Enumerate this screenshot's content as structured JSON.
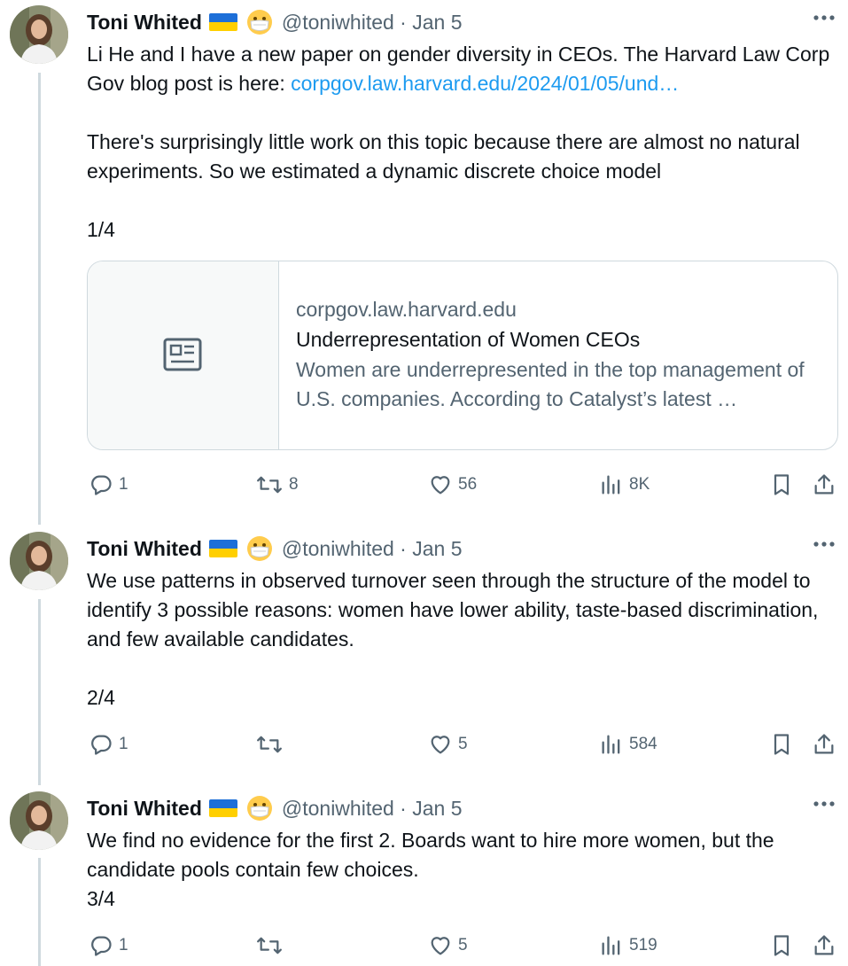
{
  "author": {
    "name": "Toni Whited",
    "handle": "@toniwhited",
    "date": "Jan 5"
  },
  "tweets": [
    {
      "body_line1_prefix": "Li He and I have a new paper on gender diversity in CEOs. The Harvard Law Corp Gov blog post is here: ",
      "link": "corpgov.law.harvard.edu/2024/01/05/und…",
      "body_para2": "There's surprisingly little work on this topic because there are almost no natural experiments. So we estimated a dynamic discrete choice model",
      "counter": "1/4",
      "card": {
        "domain": "corpgov.law.harvard.edu",
        "title": "Underrepresentation of Women CEOs",
        "description": "Women are underrepresented in the top management of U.S. companies. According to Catalyst’s latest …",
        "icon": "article-icon"
      },
      "replies": "1",
      "reposts": "8",
      "likes": "56",
      "views": "8K"
    },
    {
      "body": "We use patterns in observed turnover seen through the structure of the model to identify 3 possible reasons: women have lower ability, taste-based discrimination, and few available candidates.",
      "counter": "2/4",
      "replies": "1",
      "reposts": "",
      "likes": "5",
      "views": "584"
    },
    {
      "body": "We find no evidence for the first 2. Boards want to hire more women, but the candidate pools contain few choices.",
      "counter": "3/4",
      "replies": "1",
      "reposts": "",
      "likes": "5",
      "views": "519"
    }
  ],
  "colors": {
    "text": "#0f1419",
    "secondary": "#536471",
    "link": "#1d9bf0",
    "border": "#cfd9de"
  }
}
